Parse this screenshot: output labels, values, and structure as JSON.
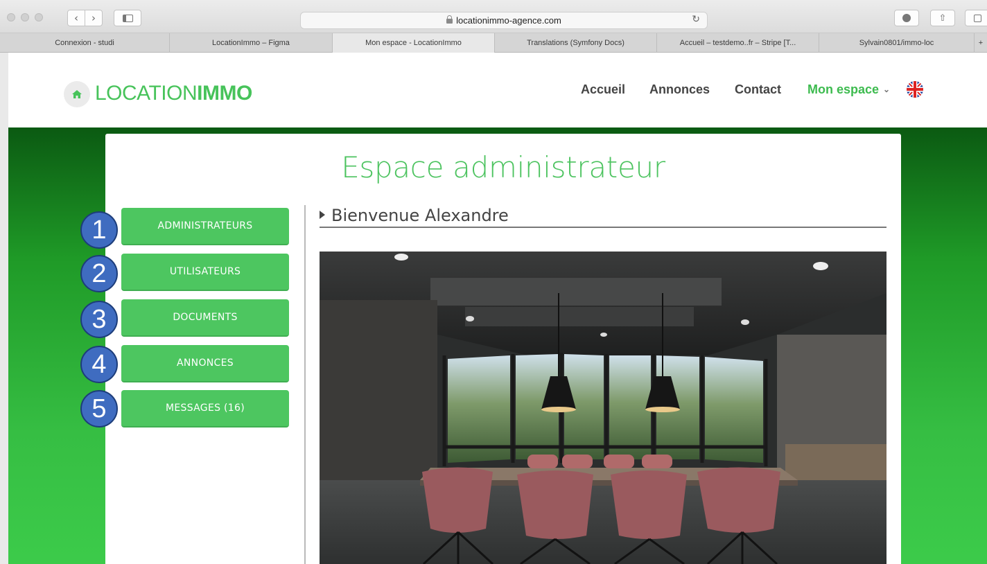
{
  "browser": {
    "url": "locationimmo-agence.com",
    "tabs": [
      {
        "label": "Connexion - studi"
      },
      {
        "label": "LocationImmo – Figma"
      },
      {
        "label": "Mon espace - LocationImmo"
      },
      {
        "label": "Translations (Symfony Docs)"
      },
      {
        "label": "Accueil – testdemo..fr – Stripe [T..."
      },
      {
        "label": "Sylvain0801/immo-loc"
      }
    ]
  },
  "header": {
    "logo_light": "LOCATION",
    "logo_bold": "IMMO",
    "nav": [
      {
        "label": "Accueil"
      },
      {
        "label": "Annonces"
      },
      {
        "label": "Contact"
      },
      {
        "label": "Mon espace"
      }
    ],
    "language_flag": "uk-flag-icon"
  },
  "main": {
    "title": "Espace administrateur",
    "welcome": "Bienvenue Alexandre",
    "menu": [
      {
        "number": "1",
        "label": "ADMINISTRATEURS"
      },
      {
        "number": "2",
        "label": "UTILISATEURS"
      },
      {
        "number": "3",
        "label": "DOCUMENTS"
      },
      {
        "number": "4",
        "label": "ANNONCES"
      },
      {
        "number": "5",
        "label": "MESSAGES (16)"
      }
    ]
  },
  "colors": {
    "brand_green": "#4dc660",
    "badge_blue": "#3f6cc0"
  }
}
